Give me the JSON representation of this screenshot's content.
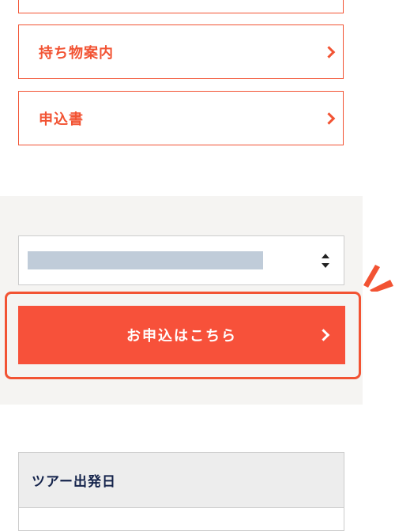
{
  "links": [
    {
      "label": ""
    },
    {
      "label": "持ち物案内"
    },
    {
      "label": "申込書"
    }
  ],
  "apply": {
    "label": "お申込はこちら"
  },
  "tour_table": {
    "header": "ツアー出発日"
  },
  "colors": {
    "accent": "#f25333",
    "panel": "#f5f4f2",
    "heading": "#14234b"
  }
}
